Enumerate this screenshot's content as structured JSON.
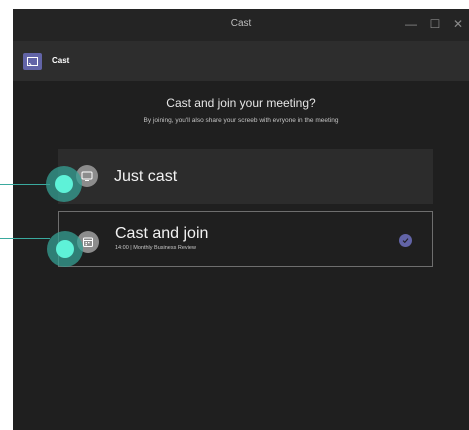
{
  "window": {
    "title": "Cast",
    "minimize_glyph": "—",
    "maximize_glyph": "☐",
    "close_glyph": "✕"
  },
  "app": {
    "title": "Cast",
    "icon": "cast-icon"
  },
  "prompt": {
    "heading": "Cast and join your meeting?",
    "subheading": "By joining, you'll also share your screeb with evryone in the meeting"
  },
  "options": [
    {
      "label": "Just cast",
      "subtitle": "",
      "icon": "monitor-icon",
      "selected": false
    },
    {
      "label": "Cast and join",
      "subtitle": "14:00 | Monthly Business Review",
      "icon": "calendar-icon",
      "selected": true
    }
  ],
  "colors": {
    "accent": "#6264a7",
    "hotspot": "#5ef2d8",
    "background": "#1f1f1f"
  }
}
